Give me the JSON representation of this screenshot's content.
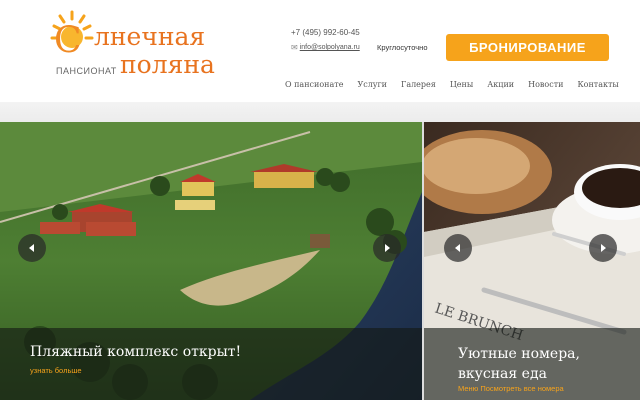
{
  "logo": {
    "first_letter": "С",
    "line1_rest": "лнечная",
    "line2": "поляна",
    "subtitle": "ПАНСИОНАТ"
  },
  "contacts": {
    "phone": "+7 (495) 992-60-45",
    "email": "info@solpolyana.ru",
    "hours": "Круглосуточно"
  },
  "booking_button": "БРОНИРОВАНИЕ",
  "nav": [
    "О пансионате",
    "Услуги",
    "Галерея",
    "Цены",
    "Акции",
    "Новости",
    "Контакты"
  ],
  "slides": {
    "left": {
      "title": "Пляжный комплекс открыт!",
      "link": "узнать больше"
    },
    "right": {
      "title_line1": "Уютные номера,",
      "title_line2": "вкусная еда",
      "link": "Меню Посмотреть все номера"
    }
  },
  "colors": {
    "brand_orange": "#f6a31b",
    "logo_orange": "#e8731f"
  }
}
